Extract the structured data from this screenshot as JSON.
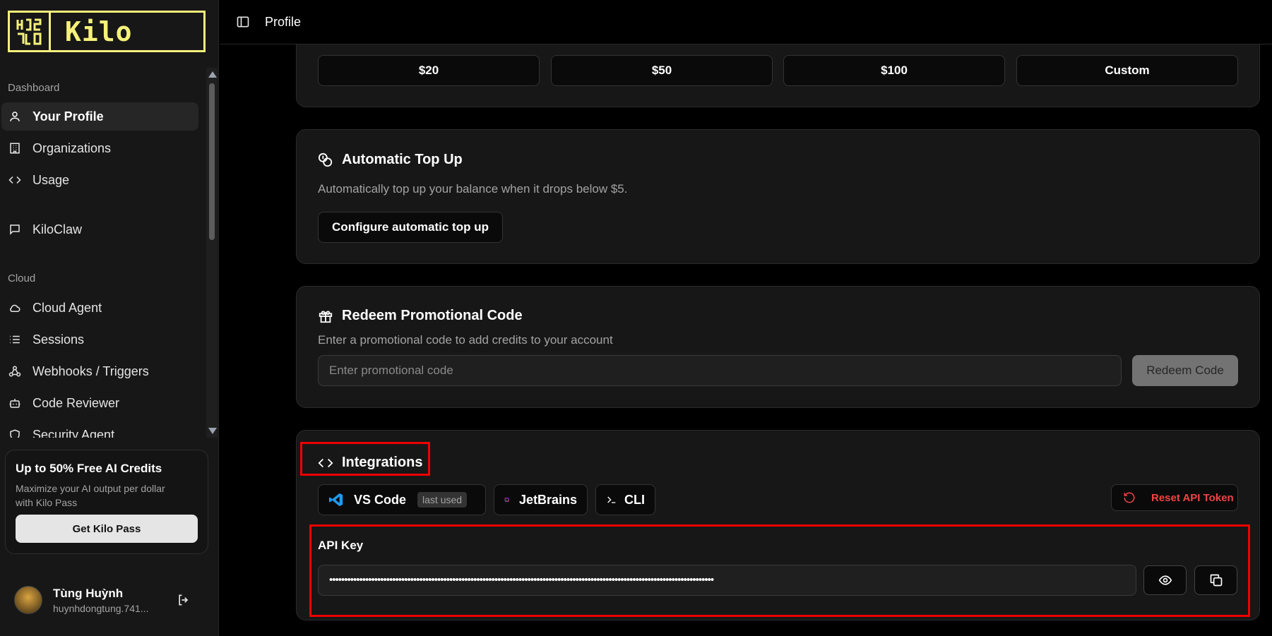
{
  "sidebar": {
    "logo_text": "Kilo",
    "sections": {
      "dashboard": "Dashboard",
      "cloud": "Cloud"
    },
    "items": [
      {
        "label": "Your Profile",
        "icon": "user-icon"
      },
      {
        "label": "Organizations",
        "icon": "building-icon"
      },
      {
        "label": "Usage",
        "icon": "code-icon"
      },
      {
        "label": "KiloClaw",
        "icon": "chat-icon"
      },
      {
        "label": "Cloud Agent",
        "icon": "cloud-icon"
      },
      {
        "label": "Sessions",
        "icon": "list-icon"
      },
      {
        "label": "Webhooks / Triggers",
        "icon": "webhook-icon"
      },
      {
        "label": "Code Reviewer",
        "icon": "bot-icon"
      },
      {
        "label": "Security Agent",
        "icon": "shield-icon"
      }
    ],
    "promo": {
      "title": "Up to 50% Free AI Credits",
      "description": "Maximize your AI output per dollar with Kilo Pass",
      "button": "Get Kilo Pass"
    },
    "user": {
      "name": "Tùng Huỳnh",
      "email": "huynhdongtung.741..."
    }
  },
  "header": {
    "title": "Profile"
  },
  "topup": {
    "amounts": [
      "$20",
      "$50",
      "$100",
      "Custom"
    ]
  },
  "auto_topup": {
    "title": "Automatic Top Up",
    "description": "Automatically top up your balance when it drops below $5.",
    "button": "Configure automatic top up"
  },
  "redeem": {
    "title": "Redeem Promotional Code",
    "description": "Enter a promotional code to add credits to your account",
    "placeholder": "Enter promotional code",
    "button": "Redeem Code"
  },
  "integrations": {
    "title": "Integrations",
    "tabs": [
      {
        "label": "VS Code",
        "badge": "last used"
      },
      {
        "label": "JetBrains"
      },
      {
        "label": "CLI"
      }
    ],
    "reset_button": "Reset API Token",
    "api_key_label": "API Key",
    "api_key_value": "••••••••••••••••••••••••••••••••••••••••••••••••••••••••••••••••••••••••••••••••••••••••••••••••••••••••••••••••••••••••••••••••"
  },
  "colors": {
    "accent_yellow": "#f5f17a",
    "danger_red": "#ef4444",
    "highlight_red": "#ee0000"
  }
}
